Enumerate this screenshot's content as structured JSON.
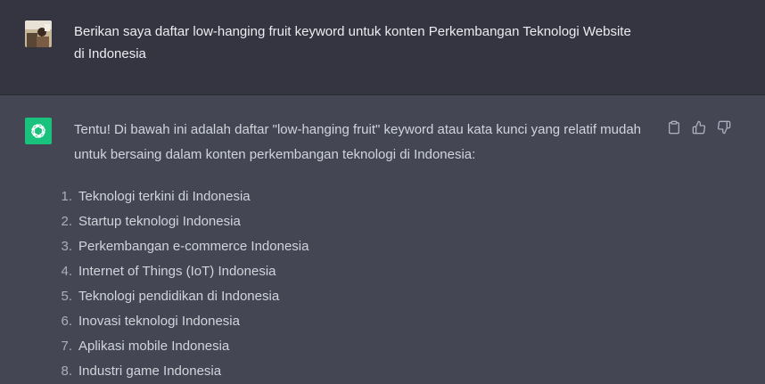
{
  "user_message": {
    "avatar_icon": "user-photo-avatar",
    "text": "Berikan saya daftar low-hanging fruit keyword untuk konten Perkembangan Teknologi Website di Indonesia"
  },
  "assistant_message": {
    "logo_icon": "openai-logo-icon",
    "logo_color": "#19c37d",
    "intro": "Tentu! Di bawah ini adalah daftar \"low-hanging fruit\" keyword atau kata kunci yang relatif mudah untuk bersaing dalam konten perkembangan teknologi di Indonesia:",
    "items": [
      {
        "num": "1.",
        "text": "Teknologi terkini di Indonesia"
      },
      {
        "num": "2.",
        "text": "Startup teknologi Indonesia"
      },
      {
        "num": "3.",
        "text": "Perkembangan e-commerce Indonesia"
      },
      {
        "num": "4.",
        "text": "Internet of Things (IoT) Indonesia"
      },
      {
        "num": "5.",
        "text": "Teknologi pendidikan di Indonesia"
      },
      {
        "num": "6.",
        "text": "Inovasi teknologi Indonesia"
      },
      {
        "num": "7.",
        "text": "Aplikasi mobile Indonesia"
      },
      {
        "num": "8.",
        "text": "Industri game Indonesia"
      }
    ],
    "actions": [
      "clipboard-icon",
      "thumbs-up-icon",
      "thumbs-down-icon"
    ]
  }
}
